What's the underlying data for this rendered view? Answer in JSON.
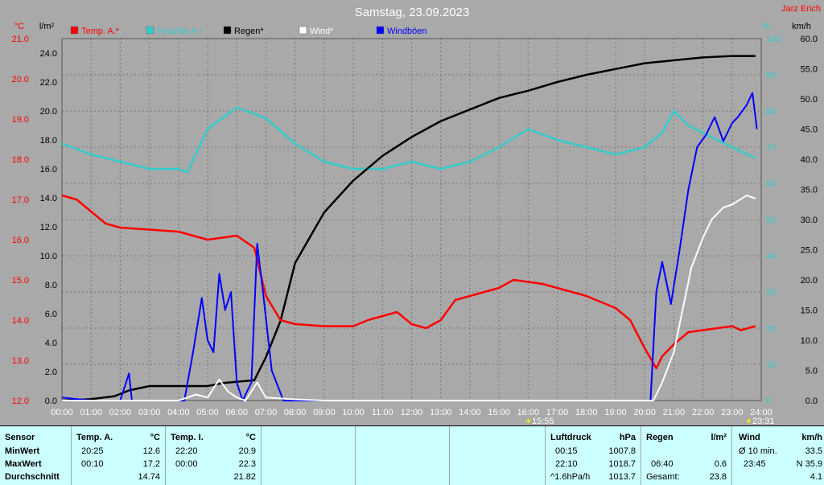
{
  "title": "Samstag, 23.09.2023",
  "author": "Jarz Erich",
  "units": {
    "left1": "°C",
    "left2": "l/m²",
    "right1": "%",
    "right2": "km/h"
  },
  "legend": [
    {
      "label": "Temp. A.*",
      "color": "#ff0000"
    },
    {
      "label": "Feuchte A.*",
      "color": "#33cccc"
    },
    {
      "label": "Regen*",
      "color": "#000000"
    },
    {
      "label": "Wind*",
      "color": "#ffffff"
    },
    {
      "label": "Windböen",
      "color": "#0000ff"
    }
  ],
  "markers": {
    "sunrise": "15:55",
    "sunset": "23:31"
  },
  "chart_data": {
    "type": "line",
    "x_ticks": [
      "00:00",
      "01:00",
      "02:00",
      "03:00",
      "04:00",
      "05:00",
      "06:00",
      "07:00",
      "08:00",
      "09:00",
      "10:00",
      "11:00",
      "12:00",
      "13:00",
      "14:00",
      "15:00",
      "16:00",
      "17:00",
      "18:00",
      "19:00",
      "20:00",
      "21:00",
      "22:00",
      "23:00",
      "24:00"
    ],
    "axes": {
      "temp_c": {
        "range": [
          12.0,
          21.0
        ],
        "ticks": [
          "12.0",
          "13.0",
          "14.0",
          "15.0",
          "16.0",
          "17.0",
          "18.0",
          "19.0",
          "20.0",
          "21.0"
        ]
      },
      "rain_lm2": {
        "range": [
          0.0,
          25.0
        ],
        "ticks": [
          "0.0",
          "2.0",
          "4.0",
          "6.0",
          "8.0",
          "10.0",
          "12.0",
          "14.0",
          "16.0",
          "18.0",
          "20.0",
          "22.0",
          "24.0"
        ]
      },
      "humidity_pct": {
        "range": [
          0,
          100
        ],
        "ticks": [
          "0",
          "10",
          "20",
          "30",
          "40",
          "50",
          "60",
          "70",
          "80",
          "90",
          "100"
        ]
      },
      "wind_kmh": {
        "range": [
          0.0,
          60.0
        ],
        "ticks": [
          "0.0",
          "5.0",
          "10.0",
          "15.0",
          "20.0",
          "25.0",
          "30.0",
          "35.0",
          "40.0",
          "45.0",
          "50.0",
          "55.0",
          "60.0"
        ]
      }
    },
    "series": [
      {
        "name": "Temp. A.*",
        "color": "#ff0000",
        "axis": "temp_c",
        "points": [
          [
            0,
            17.1
          ],
          [
            0.5,
            17.0
          ],
          [
            1,
            16.7
          ],
          [
            1.5,
            16.4
          ],
          [
            2,
            16.3
          ],
          [
            3,
            16.25
          ],
          [
            4,
            16.2
          ],
          [
            5,
            16.0
          ],
          [
            6,
            16.1
          ],
          [
            6.6,
            15.8
          ],
          [
            7,
            14.6
          ],
          [
            7.5,
            14.0
          ],
          [
            8,
            13.9
          ],
          [
            9,
            13.85
          ],
          [
            10,
            13.85
          ],
          [
            10.5,
            14.0
          ],
          [
            11,
            14.1
          ],
          [
            11.5,
            14.2
          ],
          [
            12,
            13.9
          ],
          [
            12.5,
            13.8
          ],
          [
            13,
            14.0
          ],
          [
            13.5,
            14.5
          ],
          [
            14,
            14.6
          ],
          [
            15,
            14.8
          ],
          [
            15.5,
            15.0
          ],
          [
            16,
            14.95
          ],
          [
            16.5,
            14.9
          ],
          [
            17,
            14.8
          ],
          [
            18,
            14.6
          ],
          [
            19,
            14.3
          ],
          [
            19.5,
            14.0
          ],
          [
            20,
            13.3
          ],
          [
            20.4,
            12.8
          ],
          [
            20.6,
            13.1
          ],
          [
            21,
            13.4
          ],
          [
            21.5,
            13.7
          ],
          [
            22,
            13.75
          ],
          [
            22.5,
            13.8
          ],
          [
            23,
            13.85
          ],
          [
            23.3,
            13.75
          ],
          [
            23.8,
            13.85
          ]
        ]
      },
      {
        "name": "Feuchte A.*",
        "color": "#33cccc",
        "axis": "humidity_pct",
        "points": [
          [
            0,
            71
          ],
          [
            1,
            68
          ],
          [
            2,
            66
          ],
          [
            3,
            64
          ],
          [
            4,
            64
          ],
          [
            4.3,
            63
          ],
          [
            5,
            75
          ],
          [
            6,
            81
          ],
          [
            7,
            78
          ],
          [
            8,
            71
          ],
          [
            9,
            66
          ],
          [
            10,
            64
          ],
          [
            11,
            64
          ],
          [
            12,
            66
          ],
          [
            13,
            64
          ],
          [
            14,
            66
          ],
          [
            15,
            70
          ],
          [
            16,
            75
          ],
          [
            17,
            72
          ],
          [
            18,
            70
          ],
          [
            19,
            68
          ],
          [
            20,
            70
          ],
          [
            20.6,
            74
          ],
          [
            21,
            80
          ],
          [
            21.5,
            76
          ],
          [
            22,
            74
          ],
          [
            23,
            70
          ],
          [
            23.8,
            67
          ]
        ]
      },
      {
        "name": "Regen*",
        "color": "#000000",
        "axis": "rain_lm2",
        "points": [
          [
            0,
            0
          ],
          [
            1,
            0.1
          ],
          [
            1.8,
            0.3
          ],
          [
            2.3,
            0.7
          ],
          [
            3,
            1.0
          ],
          [
            4,
            1.0
          ],
          [
            5,
            1.0
          ],
          [
            5.5,
            1.2
          ],
          [
            6,
            1.3
          ],
          [
            6.6,
            1.4
          ],
          [
            7,
            3.0
          ],
          [
            7.5,
            5.5
          ],
          [
            8,
            9.5
          ],
          [
            9,
            13.0
          ],
          [
            10,
            15.2
          ],
          [
            11,
            16.9
          ],
          [
            12,
            18.2
          ],
          [
            13,
            19.3
          ],
          [
            14,
            20.1
          ],
          [
            15,
            20.9
          ],
          [
            16,
            21.4
          ],
          [
            17,
            22.0
          ],
          [
            18,
            22.5
          ],
          [
            19,
            22.9
          ],
          [
            20,
            23.3
          ],
          [
            21,
            23.5
          ],
          [
            22,
            23.7
          ],
          [
            23,
            23.8
          ],
          [
            23.8,
            23.8
          ]
        ]
      },
      {
        "name": "Wind*",
        "color": "#ffffff",
        "axis": "wind_kmh",
        "points": [
          [
            0,
            0
          ],
          [
            4,
            0
          ],
          [
            4.3,
            0.5
          ],
          [
            4.6,
            1
          ],
          [
            5,
            0.5
          ],
          [
            5.4,
            3.5
          ],
          [
            5.7,
            1.5
          ],
          [
            6,
            0.5
          ],
          [
            6.3,
            0
          ],
          [
            6.7,
            3.0
          ],
          [
            7,
            0.5
          ],
          [
            8,
            0.2
          ],
          [
            9,
            0
          ],
          [
            20.3,
            0
          ],
          [
            20.6,
            3
          ],
          [
            21,
            8
          ],
          [
            21.3,
            15
          ],
          [
            21.6,
            22
          ],
          [
            22,
            27
          ],
          [
            22.3,
            30
          ],
          [
            22.7,
            32
          ],
          [
            23,
            32.5
          ],
          [
            23.5,
            34
          ],
          [
            23.8,
            33.5
          ]
        ]
      },
      {
        "name": "Windböen",
        "color": "#0000ff",
        "axis": "wind_kmh",
        "points": [
          [
            0,
            0.5
          ],
          [
            1,
            0
          ],
          [
            2,
            0
          ],
          [
            2.3,
            4.5
          ],
          [
            2.4,
            0
          ],
          [
            4.2,
            0
          ],
          [
            4.5,
            8
          ],
          [
            4.8,
            17
          ],
          [
            5,
            10
          ],
          [
            5.2,
            8
          ],
          [
            5.4,
            21
          ],
          [
            5.6,
            15
          ],
          [
            5.8,
            18
          ],
          [
            6,
            3
          ],
          [
            6.2,
            0
          ],
          [
            6.5,
            3
          ],
          [
            6.7,
            26
          ],
          [
            6.9,
            18
          ],
          [
            7.2,
            5
          ],
          [
            7.6,
            0
          ],
          [
            20.2,
            0
          ],
          [
            20.4,
            18
          ],
          [
            20.6,
            23
          ],
          [
            20.9,
            16
          ],
          [
            21.2,
            25
          ],
          [
            21.5,
            35
          ],
          [
            21.8,
            42
          ],
          [
            22.1,
            44
          ],
          [
            22.4,
            47
          ],
          [
            22.7,
            43
          ],
          [
            23,
            46
          ],
          [
            23.2,
            47
          ],
          [
            23.5,
            49
          ],
          [
            23.7,
            51
          ],
          [
            23.85,
            45
          ]
        ]
      }
    ]
  },
  "panel": {
    "sensor": {
      "header": "Sensor",
      "rows": [
        "MinWert",
        "MaxWert",
        "Durchschnitt"
      ]
    },
    "temp_a": {
      "header": "Temp. A.",
      "unit": "°C",
      "min_time": "20:25",
      "min_val": "12.6",
      "max_time": "00:10",
      "max_val": "17.2",
      "avg_val": "14.74"
    },
    "temp_i": {
      "header": "Temp. I.",
      "unit": "°C",
      "min_time": "22:20",
      "min_val": "20.9",
      "max_time": "00:00",
      "max_val": "22.3",
      "avg_val": "21.82"
    },
    "pressure": {
      "header": "Luftdruck",
      "unit": "hPa",
      "r1_time": "00:15",
      "r1_val": "1007.8",
      "r2_time": "22:10",
      "r2_val": "1018.7",
      "r3_time": "^1.6hPa/h",
      "r3_val": "1013.7"
    },
    "rain": {
      "header": "Regen",
      "unit": "l/m²",
      "r2_time": "06:40",
      "r2_val": "0.6",
      "r3_label": "Gesamt:",
      "r3_val": "23.8"
    },
    "wind": {
      "header": "Wind",
      "unit": "km/h",
      "r1_label": "Ø 10 min.",
      "r1_val": "33.5",
      "r2_time": "23:45",
      "r2_val": "N 35.9",
      "r3_val": "4.1"
    }
  }
}
